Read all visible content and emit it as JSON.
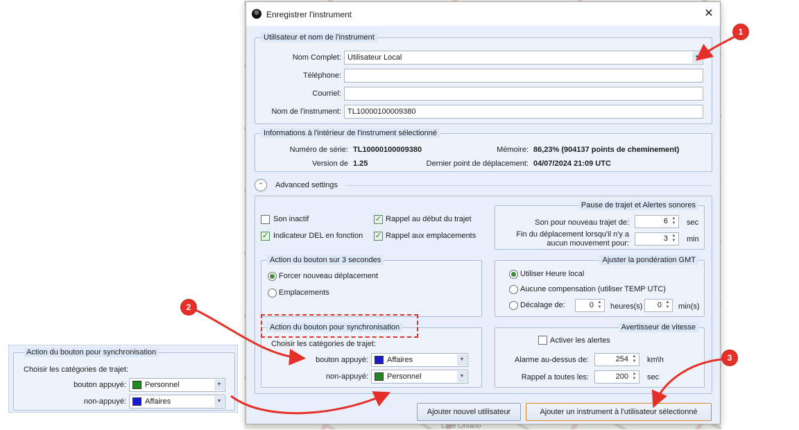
{
  "dialog": {
    "title": "Enregistrer l'instrument",
    "close_glyph": "✕"
  },
  "user_group": {
    "legend": "Utilisateur et nom de l'instrument",
    "full_name_label": "Nom Complet:",
    "full_name_value": "Utilisateur Local",
    "phone_label": "Téléphone:",
    "phone_value": "",
    "email_label": "Courriel:",
    "email_value": "",
    "instrument_name_label": "Nom de l'instrument:",
    "instrument_name_value": "TL10000100009380"
  },
  "info_group": {
    "legend": "Informations à l'intérieur de l'instrument sélectionné",
    "serial_label": "Numéro de série:",
    "serial_value": "TL10000100009380",
    "version_label": "Version de",
    "version_value": "1.25",
    "memory_label": "Mémoire:",
    "memory_value": "86,23% (904137 points de cheminement)",
    "last_point_label": "Dernier point de déplacement:",
    "last_point_value": "04/07/2024 21:09 UTC"
  },
  "advanced": {
    "label": "Advanced settings",
    "expander_glyph": "⌃"
  },
  "checkboxes": {
    "son_inactif": "Son inactif",
    "rappel_debut": "Rappel au début du trajet",
    "indicateur_del": "Indicateur DEL en fonction",
    "rappel_emplacements": "Rappel aux emplacements",
    "check_glyph": "✓"
  },
  "pause_group": {
    "legend": "Pause de trajet et Alertes sonores",
    "new_trip_label": "Son pour nouveau trajet de:",
    "new_trip_value": "6",
    "new_trip_unit": "sec",
    "end_trip_label_1": "Fin du déplacement lorsqu'il n'y a",
    "end_trip_label_2": "aucun mouvement pour:",
    "end_trip_value": "3",
    "end_trip_unit": "min"
  },
  "button3s_group": {
    "legend": "Action du bouton sur 3 secondes",
    "option1": "Forcer nouveau déplacement",
    "option2": "Emplacements"
  },
  "gmt_group": {
    "legend": "Ajuster la pondération GMT",
    "option1": "Utiliser Heure local",
    "option2": "Aucune compensation (utiliser TEMP UTC)",
    "option3": "Décalage de:",
    "hours_value": "0",
    "hours_unit": "heures(s)",
    "minutes_value": "0",
    "minutes_unit": "min(s)"
  },
  "sync_group": {
    "legend": "Action du bouton pour synchronisation",
    "instruction": "Choisir les catégories de trajet:",
    "pressed_label": "bouton appuyé:",
    "pressed_value": "Affaires",
    "pressed_color": "#1a1ad6",
    "unpressed_label": "non-appuyé:",
    "unpressed_value": "Personnel",
    "unpressed_color": "#1f8a1f"
  },
  "speed_group": {
    "legend": "Avertisseur de vitesse",
    "enable_label": "Activer les alertes",
    "alarm_label": "Alarme au-dessus de:",
    "alarm_value": "254",
    "alarm_unit": "km\\h",
    "reminder_label": "Rappel a toutes les:",
    "reminder_value": "200",
    "reminder_unit": "sec"
  },
  "footer": {
    "add_user_button": "Ajouter nouvel utilisateur",
    "add_instrument_button": "Ajouter un instrument à l'utilisateur sélectionné"
  },
  "inset": {
    "legend": "Action du bouton pour synchronisation",
    "instruction": "Choisir les catégories de trajet:",
    "pressed_label": "bouton appuyé:",
    "pressed_value": "Personnel",
    "pressed_color": "#1f8a1f",
    "unpressed_label": "non-appuyé:",
    "unpressed_value": "Affaires",
    "unpressed_color": "#1a1ad6"
  },
  "annotations": {
    "badge_1": "1",
    "badge_2": "2",
    "badge_3": "3",
    "arrow_color": "#e5302a",
    "dashed_box_color": "#e03030"
  },
  "map": {
    "label": "Lake Ontario"
  },
  "icons": {
    "dropdown": "▼",
    "spin_up": "▲",
    "spin_down": "▼"
  }
}
